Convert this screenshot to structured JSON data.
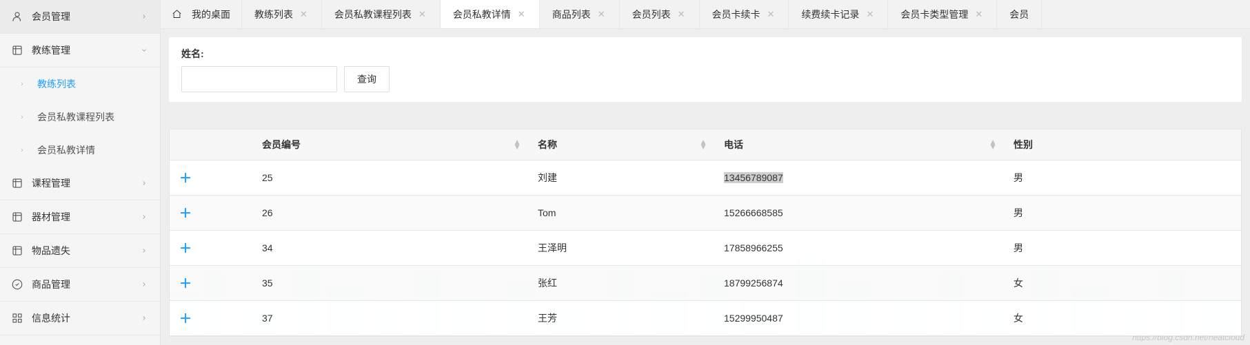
{
  "sidebar": {
    "items": [
      {
        "key": "member",
        "label": "会员管理",
        "icon": "user",
        "expand": "right"
      },
      {
        "key": "coach",
        "label": "教练管理",
        "icon": "box",
        "expand": "down",
        "children": [
          {
            "key": "coach-list",
            "label": "教练列表",
            "active": true
          },
          {
            "key": "member-course",
            "label": "会员私教课程列表",
            "active": false
          },
          {
            "key": "member-detail",
            "label": "会员私教详情",
            "active": false
          }
        ]
      },
      {
        "key": "course",
        "label": "课程管理",
        "icon": "box",
        "expand": "right"
      },
      {
        "key": "equip",
        "label": "器材管理",
        "icon": "box",
        "expand": "right"
      },
      {
        "key": "lost",
        "label": "物品遗失",
        "icon": "box",
        "expand": "right"
      },
      {
        "key": "goods",
        "label": "商品管理",
        "icon": "cart",
        "expand": "right"
      },
      {
        "key": "info",
        "label": "信息统计",
        "icon": "grid",
        "expand": "right"
      }
    ]
  },
  "tabs": [
    {
      "key": "home",
      "label": "我的桌面",
      "home": true,
      "active": false,
      "closable": false
    },
    {
      "key": "coach-list",
      "label": "教练列表",
      "home": false,
      "active": false,
      "closable": true
    },
    {
      "key": "mpcl",
      "label": "会员私教课程列表",
      "home": false,
      "active": false,
      "closable": true
    },
    {
      "key": "mpd",
      "label": "会员私教详情",
      "home": false,
      "active": true,
      "closable": true
    },
    {
      "key": "goods",
      "label": "商品列表",
      "home": false,
      "active": false,
      "closable": true
    },
    {
      "key": "members",
      "label": "会员列表",
      "home": false,
      "active": false,
      "closable": true
    },
    {
      "key": "renew",
      "label": "会员卡续卡",
      "home": false,
      "active": false,
      "closable": true
    },
    {
      "key": "renewlog",
      "label": "续费续卡记录",
      "home": false,
      "active": false,
      "closable": true
    },
    {
      "key": "cardtype",
      "label": "会员卡类型管理",
      "home": false,
      "active": false,
      "closable": true
    },
    {
      "key": "memb-edge",
      "label": "会员",
      "home": false,
      "active": false,
      "closable": false
    }
  ],
  "search": {
    "label": "姓名:",
    "value": "",
    "placeholder": "",
    "button": "查询"
  },
  "table": {
    "headers": {
      "id": "会员编号",
      "name": "名称",
      "tel": "电话",
      "gender": "性别"
    },
    "rows": [
      {
        "id": "25",
        "name": "刘建",
        "tel": "13456789087",
        "gender": "男",
        "tel_highlight": true
      },
      {
        "id": "26",
        "name": "Tom",
        "tel": "15266668585",
        "gender": "男",
        "tel_highlight": false
      },
      {
        "id": "34",
        "name": "王泽明",
        "tel": "17858966255",
        "gender": "男",
        "tel_highlight": false
      },
      {
        "id": "35",
        "name": "张红",
        "tel": "18799256874",
        "gender": "女",
        "tel_highlight": false
      },
      {
        "id": "37",
        "name": "王芳",
        "tel": "15299950487",
        "gender": "女",
        "tel_highlight": false
      }
    ]
  },
  "watermark": "https://blog.csdn.net/neatcloud"
}
